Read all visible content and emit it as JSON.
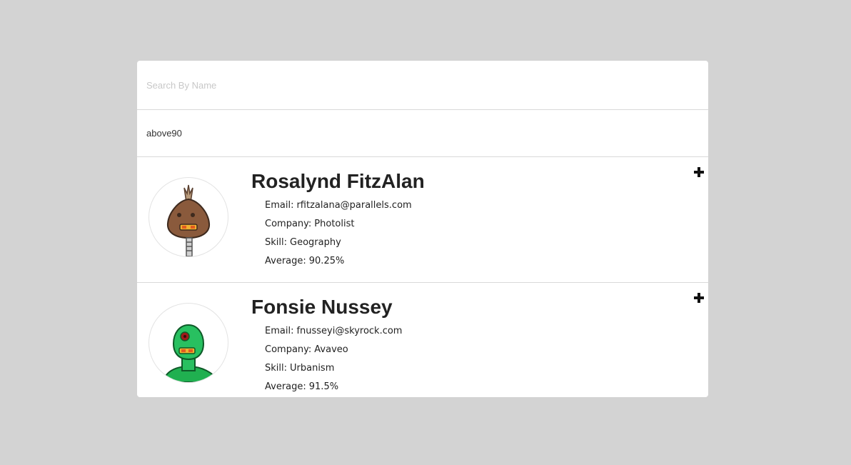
{
  "search": {
    "placeholder": "Search By Name",
    "value": ""
  },
  "tag_filter": {
    "value": "above90"
  },
  "students": [
    {
      "name": "Rosalynd FitzAlan",
      "email_label": "Email:",
      "email": "rfitzalana@parallels.com",
      "company_label": "Company:",
      "company": "Photolist",
      "skill_label": "Skill:",
      "skill": "Geography",
      "average_label": "Average:",
      "average": "90.25%",
      "avatar_icon": "robot-brown-avatar-icon"
    },
    {
      "name": "Fonsie Nussey",
      "email_label": "Email:",
      "email": "fnusseyi@skyrock.com",
      "company_label": "Company:",
      "company": "Avaveo",
      "skill_label": "Skill:",
      "skill": "Urbanism",
      "average_label": "Average:",
      "average": "91.5%",
      "avatar_icon": "robot-green-avatar-icon"
    }
  ],
  "colors": {
    "background": "#d3d3d3",
    "card": "#ffffff",
    "divider": "#d9d9d9",
    "text": "#222222"
  }
}
